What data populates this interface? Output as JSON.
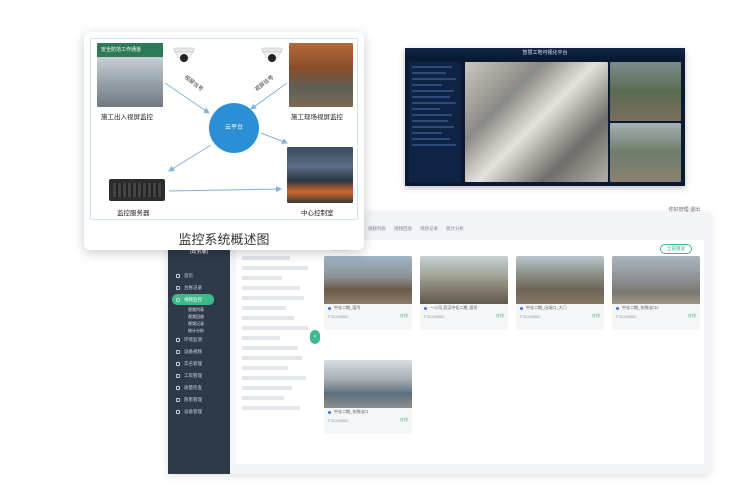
{
  "diagram": {
    "caption": "监控系统概述图",
    "cloud_label": "云平台",
    "nodes": {
      "entrance": "施工出入视屏监控",
      "site": "施工现场视屏监控",
      "server": "监控服务器",
      "control": "中心控制室"
    },
    "link_labels": [
      "视屏信号",
      "视屏信号"
    ],
    "entrance_sign": "安全防范工作通道"
  },
  "platform": {
    "title": "智慧工地可视化平台"
  },
  "webapp": {
    "brand": "(政务版)",
    "menu": [
      "首页",
      "台账记录",
      "视频监控",
      "环境监测",
      "设备视频",
      "实名管理",
      "工资管理",
      "质量检查",
      "隐患管理",
      "设备管理"
    ],
    "active_menu_index": 2,
    "submenu": [
      "视频列表",
      "视频回放",
      "视频记录",
      "统计分析"
    ],
    "tabs": [
      "视频列表",
      "视频回放",
      "视频记录",
      "统计分析"
    ],
    "content_tab": "视频列表",
    "action_button": "全部播放",
    "cameras": [
      {
        "name": "中化二期_塔吊",
        "status": "在线",
        "id": "F31248852"
      },
      {
        "name": "一公司-武汉中化二期_塔吊",
        "status": "在线",
        "id": "F31248852"
      },
      {
        "name": "中化二期_出场口_大门",
        "status": "在线",
        "id": "F31248852"
      },
      {
        "name": "中化二期_东侧出口2",
        "status": "在线",
        "id": "F31248852"
      },
      {
        "name": "中化二期_东侧出口",
        "status": "在线",
        "id": "F31248852"
      }
    ],
    "top_right": "你好管理 退出"
  }
}
